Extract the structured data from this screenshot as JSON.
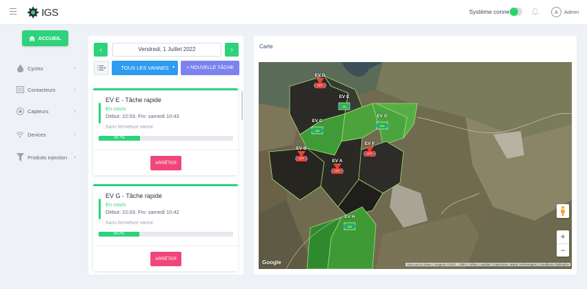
{
  "app": {
    "logo_text": "IGS",
    "system_status_label": "Système connecté",
    "avatar_initial": "A",
    "user_name": "Admin"
  },
  "sidebar": {
    "home_label": "ACCUEIL",
    "items": [
      {
        "label": "Cycles",
        "icon": "drop-icon"
      },
      {
        "label": "Contacteurs",
        "icon": "contactor-icon"
      },
      {
        "label": "Capteurs",
        "icon": "sensor-icon"
      },
      {
        "label": "Devices",
        "icon": "wifi-icon"
      },
      {
        "label": "Produits injection",
        "icon": "funnel-icon"
      }
    ]
  },
  "tasks": {
    "date": "Vendredi, 1 Juillet 2022",
    "prev_label": "‹",
    "next_label": "›",
    "filter_label": "TOUS LES VANNES",
    "new_task_label": "+ NOUVELLE TÂCHE",
    "cards": [
      {
        "title": "EV E - Tâche rapide",
        "status": "En cours",
        "time": "Début: 22:03, Fin: samedi 10:43",
        "closing": "Sans fermeture vanne",
        "progress": 0.307,
        "progress_label": "30.7%",
        "stop_label": "ARRÊTER"
      },
      {
        "title": "EV G - Tâche rapide",
        "status": "En cours",
        "time": "Début: 22:03, Fin: samedi 10:42",
        "closing": "Sans fermeture vanne",
        "progress": 0.302,
        "progress_label": "30.2%",
        "stop_label": "ARRÊTER"
      }
    ]
  },
  "map": {
    "title": "Carte",
    "google_label": "Google",
    "attribution": "Raccourcis clavier | Imagerie ©2022 , CNES / Airbus, Landsat / Copernicus, Maxar Technologies | Conditions d'utilisation",
    "zoom_in_label": "+",
    "zoom_out_label": "−",
    "valves": [
      {
        "name": "EV D",
        "state": "OFF"
      },
      {
        "name": "EV E",
        "state": "ON"
      },
      {
        "name": "EV C",
        "state": "ON"
      },
      {
        "name": "EV G",
        "state": "ON"
      },
      {
        "name": "EV F",
        "state": "OFF"
      },
      {
        "name": "EV B",
        "state": "OFF"
      },
      {
        "name": "EV A",
        "state": "OFF"
      },
      {
        "name": "EV H",
        "state": "ON"
      }
    ]
  },
  "colors": {
    "green": "#2ed27a",
    "blue": "#2f9cf2",
    "purple": "#7c83f0",
    "pink": "#f0477a",
    "valve_on": "#2bb24c",
    "valve_off": "#e5463a"
  }
}
